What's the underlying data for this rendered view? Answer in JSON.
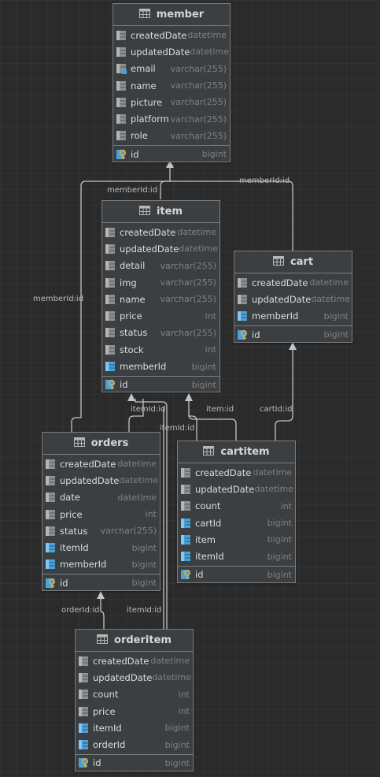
{
  "tables": [
    {
      "id": "member",
      "name": "member",
      "columns": [
        {
          "name": "createdDate",
          "type": "datetime",
          "kind": "col"
        },
        {
          "name": "updatedDate",
          "type": "datetime",
          "kind": "col"
        },
        {
          "name": "email",
          "type": "varchar(255)",
          "kind": "idx"
        },
        {
          "name": "name",
          "type": "varchar(255)",
          "kind": "col"
        },
        {
          "name": "picture",
          "type": "varchar(255)",
          "kind": "col"
        },
        {
          "name": "platform",
          "type": "varchar(255)",
          "kind": "col"
        },
        {
          "name": "role",
          "type": "varchar(255)",
          "kind": "col"
        },
        {
          "name": "id",
          "type": "bigint",
          "kind": "pk"
        }
      ]
    },
    {
      "id": "item",
      "name": "item",
      "columns": [
        {
          "name": "createdDate",
          "type": "datetime",
          "kind": "col"
        },
        {
          "name": "updatedDate",
          "type": "datetime",
          "kind": "col"
        },
        {
          "name": "detail",
          "type": "varchar(255)",
          "kind": "col"
        },
        {
          "name": "img",
          "type": "varchar(255)",
          "kind": "col"
        },
        {
          "name": "name",
          "type": "varchar(255)",
          "kind": "col"
        },
        {
          "name": "price",
          "type": "int",
          "kind": "col"
        },
        {
          "name": "status",
          "type": "varchar(255)",
          "kind": "col"
        },
        {
          "name": "stock",
          "type": "int",
          "kind": "col"
        },
        {
          "name": "memberId",
          "type": "bigint",
          "kind": "fk"
        },
        {
          "name": "id",
          "type": "bigint",
          "kind": "pk"
        }
      ]
    },
    {
      "id": "cart",
      "name": "cart",
      "columns": [
        {
          "name": "createdDate",
          "type": "datetime",
          "kind": "col"
        },
        {
          "name": "updatedDate",
          "type": "datetime",
          "kind": "col"
        },
        {
          "name": "memberId",
          "type": "bigint",
          "kind": "fk"
        },
        {
          "name": "id",
          "type": "bigint",
          "kind": "pk"
        }
      ]
    },
    {
      "id": "orders",
      "name": "orders",
      "columns": [
        {
          "name": "createdDate",
          "type": "datetime",
          "kind": "col"
        },
        {
          "name": "updatedDate",
          "type": "datetime",
          "kind": "col"
        },
        {
          "name": "date",
          "type": "datetime",
          "kind": "col"
        },
        {
          "name": "price",
          "type": "int",
          "kind": "col"
        },
        {
          "name": "status",
          "type": "varchar(255)",
          "kind": "col"
        },
        {
          "name": "itemId",
          "type": "bigint",
          "kind": "fk"
        },
        {
          "name": "memberId",
          "type": "bigint",
          "kind": "fk"
        },
        {
          "name": "id",
          "type": "bigint",
          "kind": "pk"
        }
      ]
    },
    {
      "id": "cartitem",
      "name": "cartitem",
      "columns": [
        {
          "name": "createdDate",
          "type": "datetime",
          "kind": "col"
        },
        {
          "name": "updatedDate",
          "type": "datetime",
          "kind": "col"
        },
        {
          "name": "count",
          "type": "int",
          "kind": "col"
        },
        {
          "name": "cartId",
          "type": "bigint",
          "kind": "fk"
        },
        {
          "name": "item",
          "type": "bigint",
          "kind": "fk"
        },
        {
          "name": "itemId",
          "type": "bigint",
          "kind": "fk"
        },
        {
          "name": "id",
          "type": "bigint",
          "kind": "pk"
        }
      ]
    },
    {
      "id": "orderitem",
      "name": "orderitem",
      "columns": [
        {
          "name": "createdDate",
          "type": "datetime",
          "kind": "col"
        },
        {
          "name": "updatedDate",
          "type": "datetime",
          "kind": "col"
        },
        {
          "name": "count",
          "type": "int",
          "kind": "col"
        },
        {
          "name": "price",
          "type": "int",
          "kind": "col"
        },
        {
          "name": "itemId",
          "type": "bigint",
          "kind": "fk"
        },
        {
          "name": "orderId",
          "type": "bigint",
          "kind": "fk"
        },
        {
          "name": "id",
          "type": "bigint",
          "kind": "pk"
        }
      ]
    }
  ],
  "relations": [
    {
      "id": "item-member",
      "from": "item",
      "to": "member",
      "label": "memberId:id"
    },
    {
      "id": "cart-member",
      "from": "cart",
      "to": "member",
      "label": "memberId:id"
    },
    {
      "id": "orders-member",
      "from": "orders",
      "to": "member",
      "label": "memberId:id"
    },
    {
      "id": "orders-item",
      "from": "orders",
      "to": "item",
      "label": "itemId:id"
    },
    {
      "id": "orderitem-item",
      "from": "orderitem",
      "to": "item",
      "label": "itemId:id"
    },
    {
      "id": "cartitem-item",
      "from": "cartitem",
      "to": "item",
      "label": "item:id"
    },
    {
      "id": "cartitem-cart",
      "from": "cartitem",
      "to": "cart",
      "label": "cartId:id"
    },
    {
      "id": "orderitem-orders",
      "from": "orderitem",
      "to": "orders",
      "label": "orderId:id"
    },
    {
      "id": "orderitem-item-2",
      "from": "orderitem",
      "to": "item",
      "label": "itemId:id"
    }
  ],
  "colors": {
    "background": "#2b2b2b",
    "table_bg": "#3c3f41",
    "border": "#7a7d80",
    "column_text": "#dcdcdc",
    "type_text": "#808080",
    "key_gold": "#d6a84a",
    "fk_blue": "#4aa3d8"
  }
}
